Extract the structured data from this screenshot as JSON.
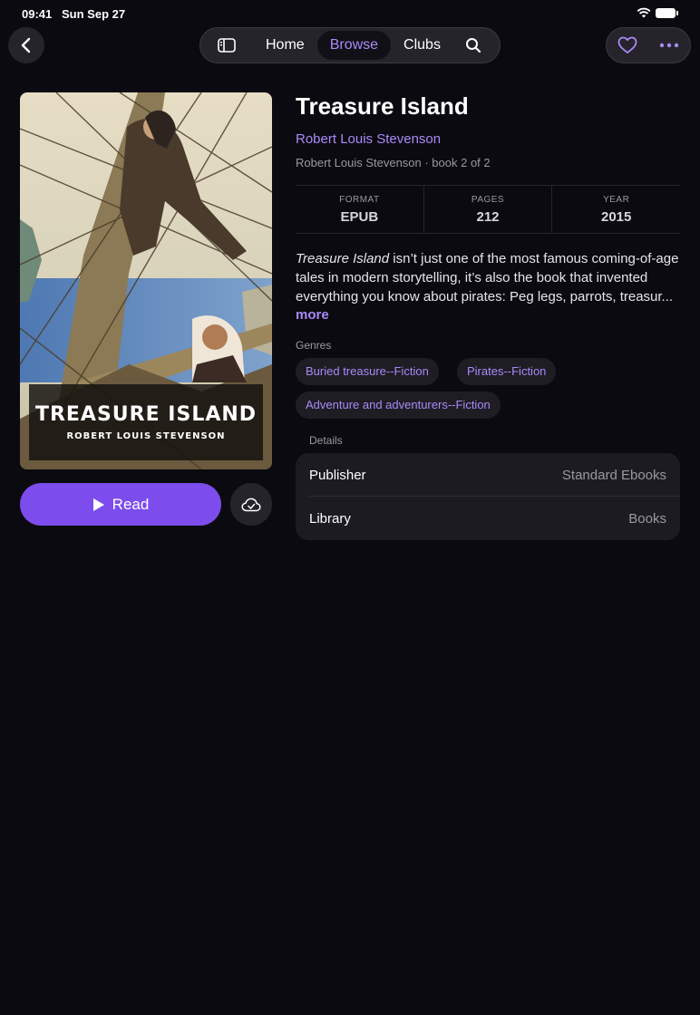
{
  "status": {
    "time": "09:41",
    "date": "Sun Sep 27"
  },
  "nav": {
    "tabs": [
      {
        "label": "Home"
      },
      {
        "label": "Browse",
        "active": true
      },
      {
        "label": "Clubs"
      }
    ]
  },
  "book": {
    "title": "Treasure Island",
    "author": "Robert Louis Stevenson",
    "series": "Robert Louis Stevenson · book 2 of 2",
    "cover": {
      "title": "TREASURE ISLAND",
      "author": "ROBERT LOUIS STEVENSON"
    },
    "stats": [
      {
        "label": "FORMAT",
        "value": "EPUB"
      },
      {
        "label": "PAGES",
        "value": "212"
      },
      {
        "label": "YEAR",
        "value": "2015"
      }
    ],
    "description_em": "Treasure Island",
    "description_rest": " isn’t just one of the most famous coming-of-age tales in modern storytelling, it’s also the book that invented everything you know about pirates: Peg legs, parrots, treasur...",
    "more_label": "more"
  },
  "actions": {
    "read_label": "Read"
  },
  "genres": {
    "label": "Genres",
    "items": [
      "Buried treasure--Fiction",
      "Pirates--Fiction",
      "Adventure and adventurers--Fiction"
    ]
  },
  "details": {
    "label": "Details",
    "rows": [
      {
        "key": "Publisher",
        "value": "Standard Ebooks"
      },
      {
        "key": "Library",
        "value": "Books"
      }
    ]
  },
  "colors": {
    "accent": "#a98af9",
    "primary_button": "#7c4dec",
    "background": "#0b0a10",
    "surface": "#25242b"
  },
  "icons": [
    "back-chevron-icon",
    "sidebar-icon",
    "search-icon",
    "heart-icon",
    "more-dots-icon",
    "play-icon",
    "cloud-download-icon",
    "wifi-icon",
    "battery-icon"
  ]
}
